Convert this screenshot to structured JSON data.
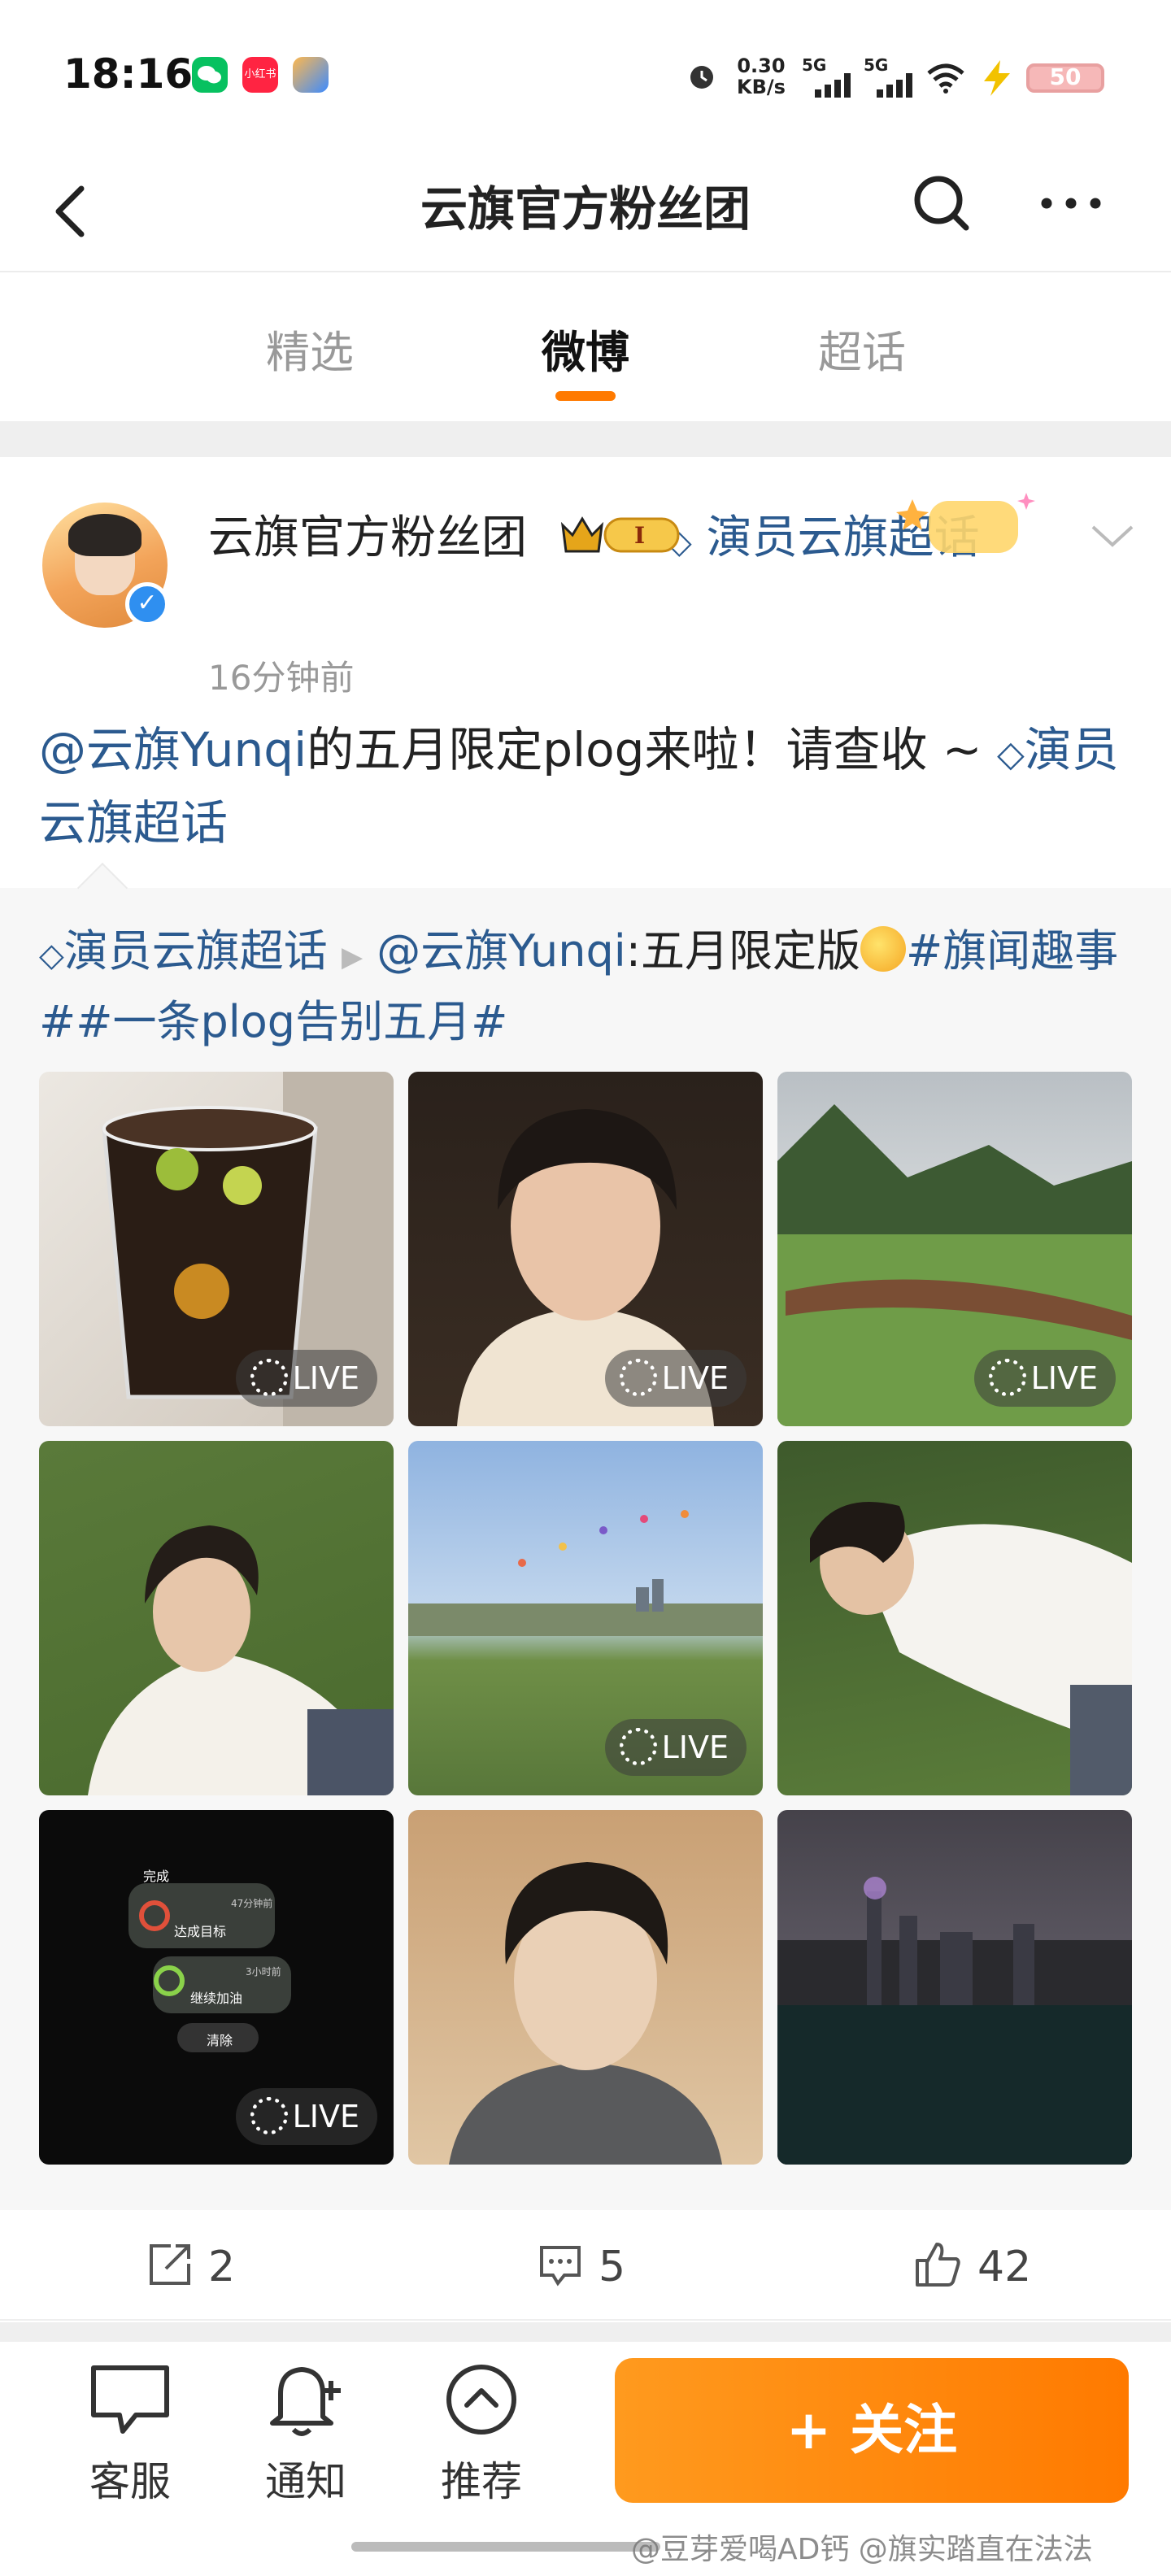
{
  "status_bar": {
    "time": "18:16",
    "net_speed_value": "0.30",
    "net_speed_unit": "KB/s",
    "sim1": "5G",
    "sim2": "5G",
    "battery": "50",
    "app_icons": [
      "wechat-icon",
      "xiaohongshu-icon",
      "app-icon"
    ],
    "xiaohongshu_label": "小红书"
  },
  "header": {
    "title": "云旗官方粉丝团"
  },
  "tabs": [
    {
      "label": "精选",
      "active": false
    },
    {
      "label": "微博",
      "active": true
    },
    {
      "label": "超话",
      "active": false
    }
  ],
  "post": {
    "author": "云旗官方粉丝团",
    "tag_link": "演员云旗超话",
    "time": "16分钟前",
    "text": {
      "mention": "@云旗Yunqi",
      "body": "的五月限定plog来啦！请查收 ~ ",
      "topic": "演员云旗超话"
    },
    "repost": {
      "topic": "演员云旗超话",
      "mention": "@云旗Yunqi",
      "body": ":五月限定版",
      "hashtags": "#旗闻趣事##一条plog告别五月#"
    },
    "photos": [
      {
        "name": "photo-drink",
        "live": true
      },
      {
        "name": "photo-selfie-1",
        "live": true
      },
      {
        "name": "photo-landscape-mountain",
        "live": true
      },
      {
        "name": "photo-lying-grass-1",
        "live": false
      },
      {
        "name": "photo-balloons-field",
        "live": true
      },
      {
        "name": "photo-lying-grass-2",
        "live": false
      },
      {
        "name": "photo-watch-screen",
        "live": true
      },
      {
        "name": "photo-selfie-2",
        "live": false
      },
      {
        "name": "photo-city-night",
        "live": false
      }
    ],
    "live_label": "LIVE",
    "watch_screen": {
      "done": "完成",
      "goal": "达成目标",
      "goal_time": "47分钟前",
      "speed": "继续加油",
      "speed_time": "3小时前",
      "clear": "清除"
    },
    "actions": {
      "reposts": "2",
      "comments": "5",
      "likes": "42"
    }
  },
  "bottom_bar": {
    "service": "客服",
    "notify": "通知",
    "recommend": "推荐",
    "follow": "+ 关注"
  },
  "watermark": "@豆芽爱喝AD钙 @旗实踏直在法法",
  "colors": {
    "accent": "#ff7a00",
    "link": "#2b5a8f",
    "verified": "#2f8ff0"
  }
}
